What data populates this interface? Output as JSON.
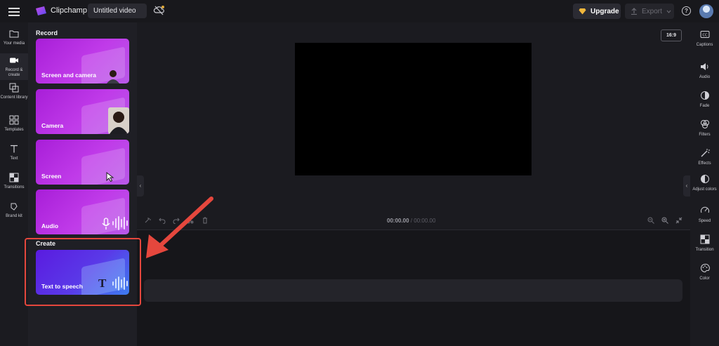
{
  "app": {
    "brand": "Clipchamp",
    "video_title": "Untitled video",
    "upgrade_label": "Upgrade",
    "export_label": "Export",
    "help_label": "?"
  },
  "left_nav": [
    {
      "label": "Your media",
      "icon": "folder-icon",
      "active": false
    },
    {
      "label": "Record & create",
      "icon": "video-camera-icon",
      "active": true
    },
    {
      "label": "Content library",
      "icon": "stack-icon",
      "active": false
    },
    {
      "label": "Templates",
      "icon": "grid-icon",
      "active": false
    },
    {
      "label": "Text",
      "icon": "text-icon",
      "active": false
    },
    {
      "label": "Transitions",
      "icon": "transition-icon",
      "active": false
    },
    {
      "label": "Brand kit",
      "icon": "brand-kit-icon",
      "active": false
    }
  ],
  "panel": {
    "record_title": "Record",
    "create_title": "Create",
    "cards": [
      {
        "label": "Screen and camera"
      },
      {
        "label": "Camera"
      },
      {
        "label": "Screen"
      },
      {
        "label": "Audio"
      }
    ],
    "create_cards": [
      {
        "label": "Text to speech",
        "glyph": "T"
      }
    ]
  },
  "preview": {
    "aspect_ratio": "16:9",
    "collapse_glyph": "‹"
  },
  "timeline": {
    "current_time": "00:00.00",
    "separator": " / ",
    "total_time": "00:00.00"
  },
  "right_bar": [
    {
      "label": "Captions",
      "icon": "captions-icon"
    },
    {
      "label": "Audio",
      "icon": "speaker-icon"
    },
    {
      "label": "Fade",
      "icon": "fade-icon"
    },
    {
      "label": "Filters",
      "icon": "filters-icon"
    },
    {
      "label": "Effects",
      "icon": "magic-wand-icon"
    },
    {
      "label": "Adjust colors",
      "icon": "adjust-colors-icon"
    },
    {
      "label": "Speed",
      "icon": "speedometer-icon"
    },
    {
      "label": "Transition",
      "icon": "transition-icon"
    },
    {
      "label": "Color",
      "icon": "palette-icon"
    }
  ],
  "colors": {
    "annotation": "#e5473d",
    "card_purple": "#b02bdf",
    "card_blue": "#5a2ee6"
  }
}
